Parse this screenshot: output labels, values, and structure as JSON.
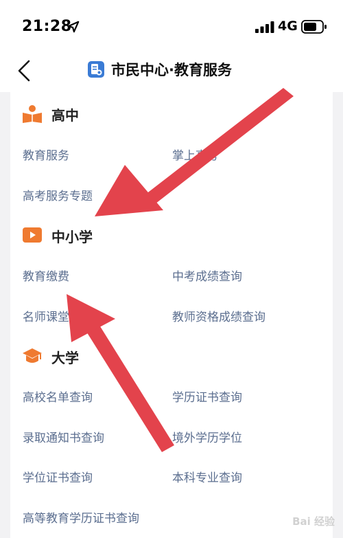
{
  "status_bar": {
    "time": "21:28",
    "network": "4G"
  },
  "nav": {
    "title": "市民中心·教育服务"
  },
  "sections": [
    {
      "title": "高中",
      "icon": "reading-person-icon",
      "items": [
        [
          "教育服务",
          "掌上高考"
        ],
        [
          "高考服务专题",
          ""
        ]
      ]
    },
    {
      "title": "中小学",
      "icon": "play-video-icon",
      "items": [
        [
          "教育缴费",
          "中考成绩查询"
        ],
        [
          "名师课堂",
          "教师资格成绩查询"
        ]
      ]
    },
    {
      "title": "大学",
      "icon": "graduation-cap-icon",
      "items": [
        [
          "高校名单查询",
          "学历证书查询"
        ],
        [
          "录取通知书查询",
          "境外学历学位"
        ],
        [
          "学位证书查询",
          "本科专业查询"
        ],
        [
          "高等教育学历证书查询",
          ""
        ]
      ]
    }
  ],
  "colors": {
    "accent_orange": "#ef7a30",
    "link_text": "#5b6e8f",
    "arrow_red": "#e3434c",
    "title_blue": "#3a7bd5"
  },
  "watermark": "Bai 经验"
}
